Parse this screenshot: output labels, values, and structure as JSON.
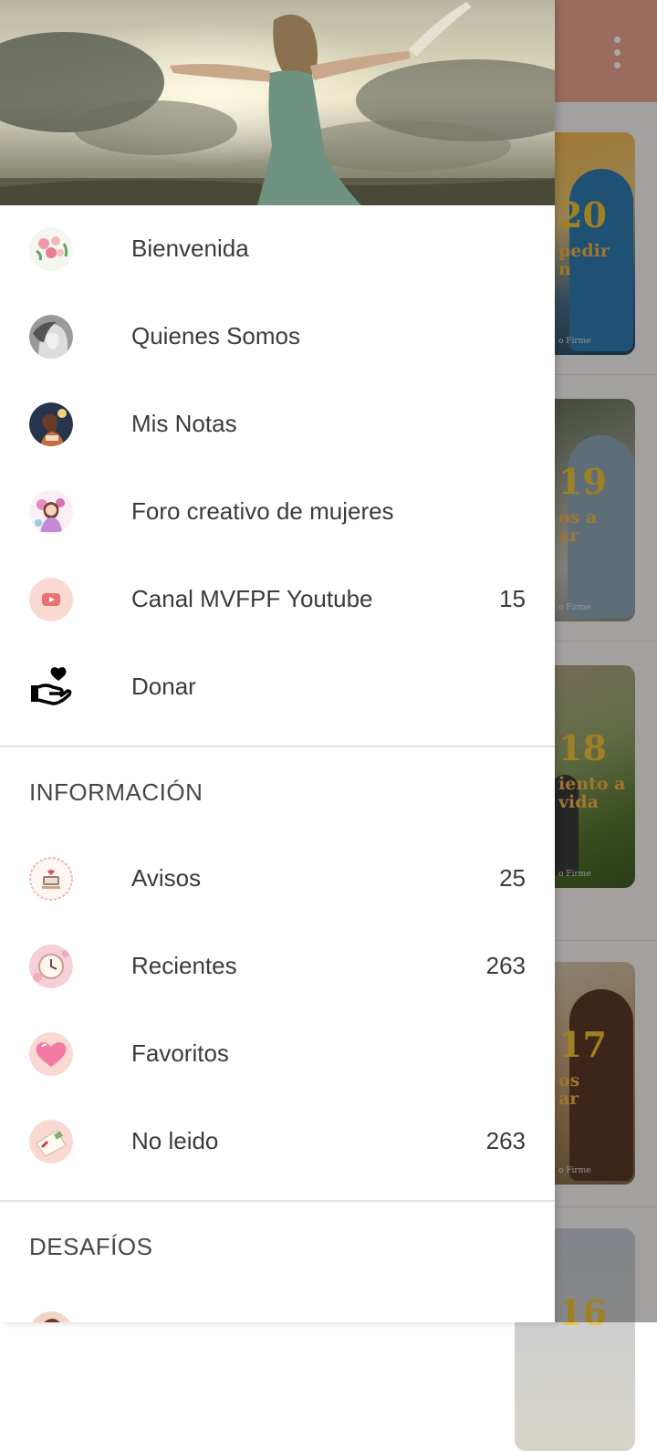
{
  "drawer": {
    "main_items": [
      {
        "label": "Bienvenida",
        "icon": "flower-bouquet-icon",
        "count": ""
      },
      {
        "label": "Quienes Somos",
        "icon": "woman-portrait-icon",
        "count": ""
      },
      {
        "label": "Mis Notas",
        "icon": "woman-reading-icon",
        "count": ""
      },
      {
        "label": "Foro creativo de mujeres",
        "icon": "doll-sticker-icon",
        "count": ""
      },
      {
        "label": "Canal MVFPF Youtube",
        "icon": "youtube-icon",
        "count": "15"
      },
      {
        "label": "Donar",
        "icon": "heart-hand-icon",
        "count": ""
      }
    ],
    "section_info": {
      "title": "INFORMACIÓN",
      "items": [
        {
          "label": "Avisos",
          "icon": "notice-board-icon",
          "count": "25"
        },
        {
          "label": "Recientes",
          "icon": "clock-icon",
          "count": "263"
        },
        {
          "label": "Favoritos",
          "icon": "heart-icon",
          "count": ""
        },
        {
          "label": "No leido",
          "icon": "envelope-icon",
          "count": "263"
        }
      ]
    },
    "section_challenges": {
      "title": "DESAFÍOS"
    }
  },
  "background_cards": [
    {
      "number": "20",
      "caption": "pedir\nn",
      "footer": "o Firme"
    },
    {
      "number": "19",
      "caption": "os a\nar",
      "footer": "o Firme"
    },
    {
      "number": "18",
      "caption": "iento a\nvida",
      "footer": "o Firme"
    },
    {
      "number": "17",
      "caption": "os\nar",
      "footer": "o Firme"
    },
    {
      "number": "16",
      "caption": "",
      "footer": ""
    }
  ],
  "colors": {
    "toolbar": "#e8a48f",
    "accent_youtube": "#e97373",
    "card_number": "#f2c236"
  }
}
